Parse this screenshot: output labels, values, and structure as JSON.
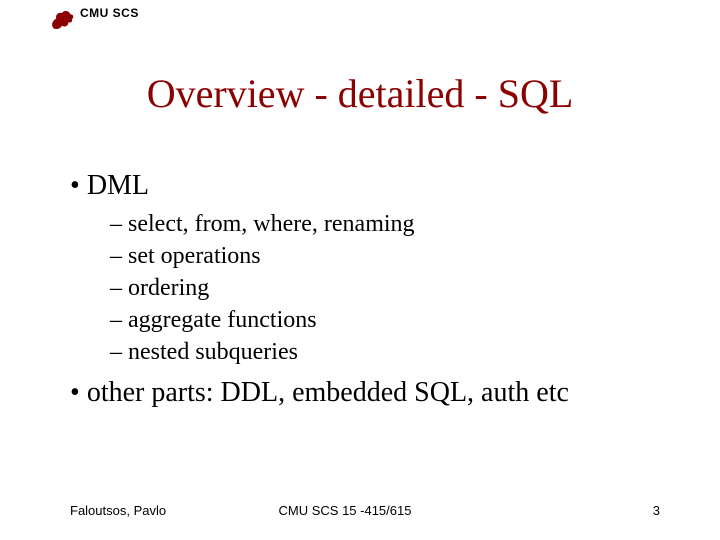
{
  "header": {
    "org_label": "CMU SCS"
  },
  "title": "Overview - detailed - SQL",
  "bullets": [
    {
      "level": 1,
      "text": "DML"
    },
    {
      "level": 2,
      "text": "select, from, where, renaming"
    },
    {
      "level": 2,
      "text": "set operations"
    },
    {
      "level": 2,
      "text": "ordering"
    },
    {
      "level": 2,
      "text": "aggregate functions"
    },
    {
      "level": 2,
      "text": "nested subqueries"
    },
    {
      "level": 1,
      "text": "other parts: DDL, embedded SQL, auth etc"
    }
  ],
  "footer": {
    "left": "Faloutsos, Pavlo",
    "center": "CMU SCS 15 -415/615",
    "right": "3"
  },
  "colors": {
    "accent": "#8b0000"
  }
}
